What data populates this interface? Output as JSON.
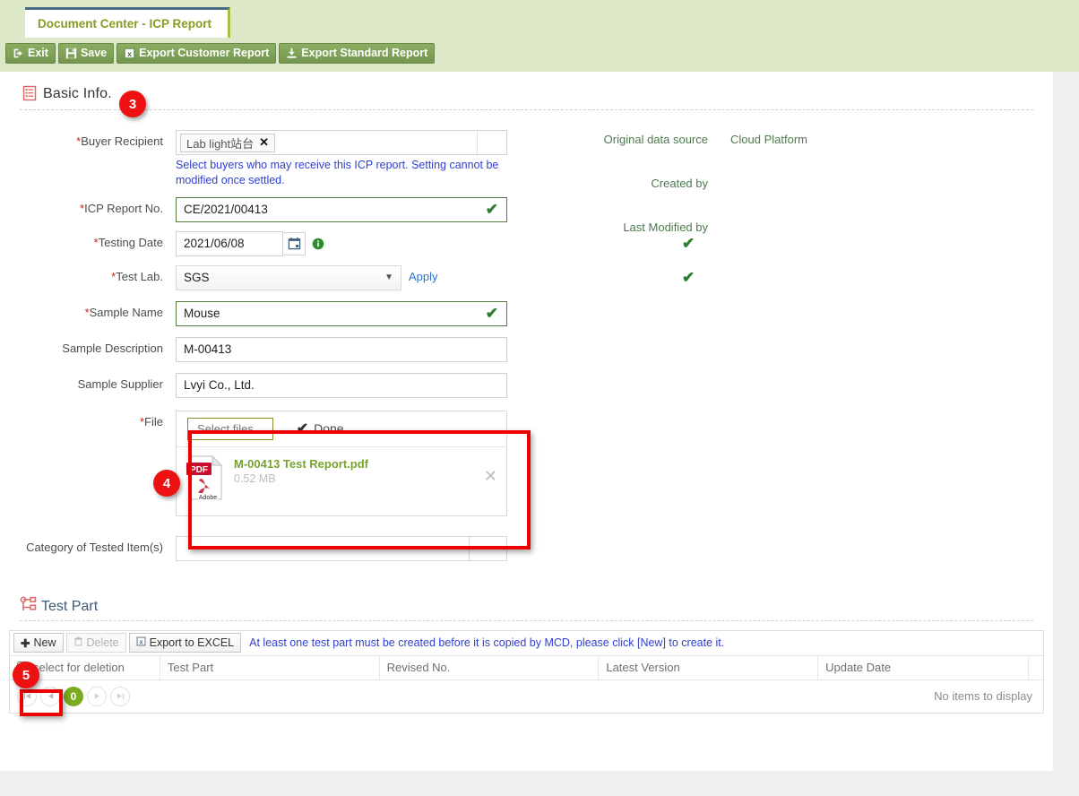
{
  "tab": {
    "label": "Document Center - ICP Report"
  },
  "toolbar": {
    "buttons": [
      {
        "label": "Exit",
        "icon": "exit-icon"
      },
      {
        "label": "Save",
        "icon": "save-disk-icon"
      },
      {
        "label": "Export Customer Report",
        "icon": "excel-icon"
      },
      {
        "label": "Export Standard Report",
        "icon": "download-icon"
      }
    ]
  },
  "basic_info": {
    "section_title": "Basic Info.",
    "section_icon": "list-document-icon",
    "badge": "3",
    "fields": {
      "buyer_recipient": {
        "label": "Buyer Recipient",
        "required": true,
        "chip": "Lab light站台",
        "hint": "Select buyers who may receive this ICP report. Setting cannot be modified once settled."
      },
      "icp_report_no": {
        "label": "ICP Report No.",
        "required": true,
        "value": "CE/2021/00413",
        "valid": true
      },
      "testing_date": {
        "label": "Testing Date",
        "required": true,
        "value": "2021/06/08",
        "valid": true
      },
      "test_lab": {
        "label": "Test Lab.",
        "required": true,
        "value": "SGS",
        "apply_link": "Apply",
        "valid": true
      },
      "sample_name": {
        "label": "Sample Name",
        "required": true,
        "value": "Mouse",
        "valid": true
      },
      "sample_description": {
        "label": "Sample Description",
        "required": false,
        "value": "M-00413"
      },
      "sample_supplier": {
        "label": "Sample Supplier",
        "required": false,
        "value": "Lvyi Co., Ltd."
      },
      "file": {
        "label": "File",
        "required": true,
        "badge": "4",
        "select_files_label": "Select files...",
        "status_label": "Done",
        "attachment": {
          "name": "M-00413 Test Report.pdf",
          "size": "0.52 MB",
          "type": "PDF"
        }
      },
      "category_of_tested_items": {
        "label": "Category of Tested Item(s)",
        "required": false,
        "value": ""
      }
    },
    "meta": [
      {
        "label": "Original data source",
        "value": "Cloud Platform"
      },
      {
        "label": "Created by",
        "value": ""
      },
      {
        "label": "Last Modified by",
        "value": ""
      }
    ]
  },
  "test_part": {
    "section_title": "Test Part",
    "section_icon": "sitemap-icon",
    "badge": "5",
    "toolbar": {
      "new_label": "New",
      "delete_label": "Delete",
      "export_label": "Export to EXCEL",
      "note": "At least one test part must be created before it is copied by MCD, please click [New] to create it."
    },
    "columns": [
      "select for deletion",
      "Test Part",
      "Revised No.",
      "Latest Version",
      "Update Date"
    ],
    "rows": [],
    "empty_message": "No items to display",
    "pager": {
      "first": "⏮",
      "prev": "◀",
      "page": "0",
      "next": "▶",
      "last": "⏭"
    }
  },
  "colors": {
    "accent_green": "#7fa05a",
    "tab_text": "#8a9a21",
    "badge_red": "#ee1111",
    "link_blue": "#2f3fd0",
    "valid_green": "#2e7d32"
  }
}
